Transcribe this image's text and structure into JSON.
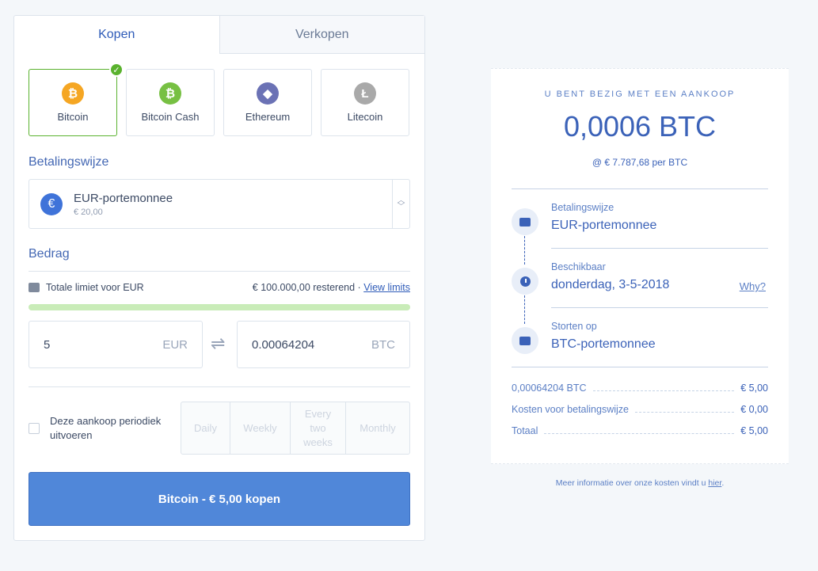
{
  "tabs": {
    "buy": "Kopen",
    "sell": "Verkopen"
  },
  "coins": [
    {
      "name": "Bitcoin",
      "symbol": "₿",
      "color": "#f5a623",
      "selected": true
    },
    {
      "name": "Bitcoin Cash",
      "symbol": "₿",
      "color": "#77c043",
      "selected": false
    },
    {
      "name": "Ethereum",
      "symbol": "◆",
      "color": "#6b72b5",
      "selected": false
    },
    {
      "name": "Litecoin",
      "symbol": "Ł",
      "color": "#a9a9a9",
      "selected": false
    }
  ],
  "payment": {
    "label": "Betalingswijze",
    "method": "EUR-portemonnee",
    "balance": "€ 20,00",
    "icon": "euro-icon"
  },
  "amount": {
    "label": "Bedrag",
    "limit_label": "Totale limiet voor EUR",
    "limit_remaining": "€ 100.000,00 resterend ·",
    "view_limits": "View limits",
    "limit_used_fraction": 0.0,
    "fiat_value": "5",
    "fiat_currency": "EUR",
    "crypto_value": "0.00064204",
    "crypto_currency": "BTC"
  },
  "recurring": {
    "label": "Deze aankoop periodiek uitvoeren",
    "options": [
      "Daily",
      "Weekly",
      "Every two weeks",
      "Monthly"
    ]
  },
  "buy_button": "Bitcoin - € 5,00 kopen",
  "receipt": {
    "title": "U BENT BEZIG MET EEN AANKOOP",
    "amount": "0,0006 BTC",
    "rate": "@ € 7.787,68 per BTC",
    "steps": [
      {
        "label": "Betalingswijze",
        "value": "EUR-portemonnee",
        "icon": "wallet-icon"
      },
      {
        "label": "Beschikbaar",
        "value": "donderdag, 3-5-2018",
        "icon": "clock-icon",
        "link": "Why?"
      },
      {
        "label": "Storten op",
        "value": "BTC-portemonnee",
        "icon": "wallet-icon"
      }
    ],
    "lines": [
      {
        "label": "0,00064204 BTC",
        "value": "€ 5,00"
      },
      {
        "label": "Kosten voor betalingswijze",
        "value": "€ 0,00"
      },
      {
        "label": "Totaal",
        "value": "€ 5,00"
      }
    ]
  },
  "footnote": {
    "text": "Meer informatie over onze kosten vindt u ",
    "link": "hier",
    "end": "."
  },
  "colors": {
    "accent": "#2e5bb8",
    "button": "#5087d9",
    "success": "#5ab22e",
    "limit_bar": "#c9ecb8"
  }
}
